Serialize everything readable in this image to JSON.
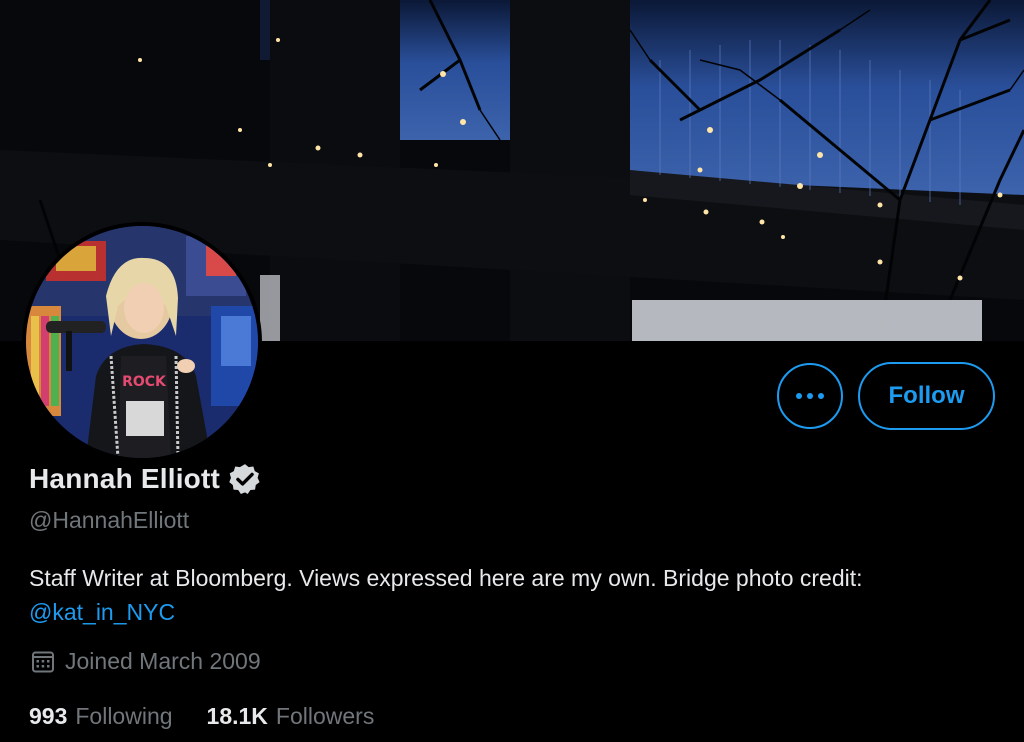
{
  "profile": {
    "display_name": "Hannah Elliott",
    "handle": "@HannahElliott",
    "bio_text": "Staff Writer at Bloomberg. Views expressed here are my own. Bridge photo credit: ",
    "bio_link": "@kat_in_NYC",
    "joined": "Joined March 2009",
    "verified_icon": "verified-badge-icon",
    "calendar_icon": "calendar-icon"
  },
  "actions": {
    "more_icon": "more-dots-icon",
    "follow_label": "Follow"
  },
  "stats": {
    "following_count": "993",
    "following_label": "Following",
    "followers_count": "18.1K",
    "followers_label": "Followers"
  },
  "colors": {
    "background": "#000000",
    "accent": "#1d9bf0",
    "primary_text": "#e7e9ea",
    "secondary_text": "#71767b"
  }
}
